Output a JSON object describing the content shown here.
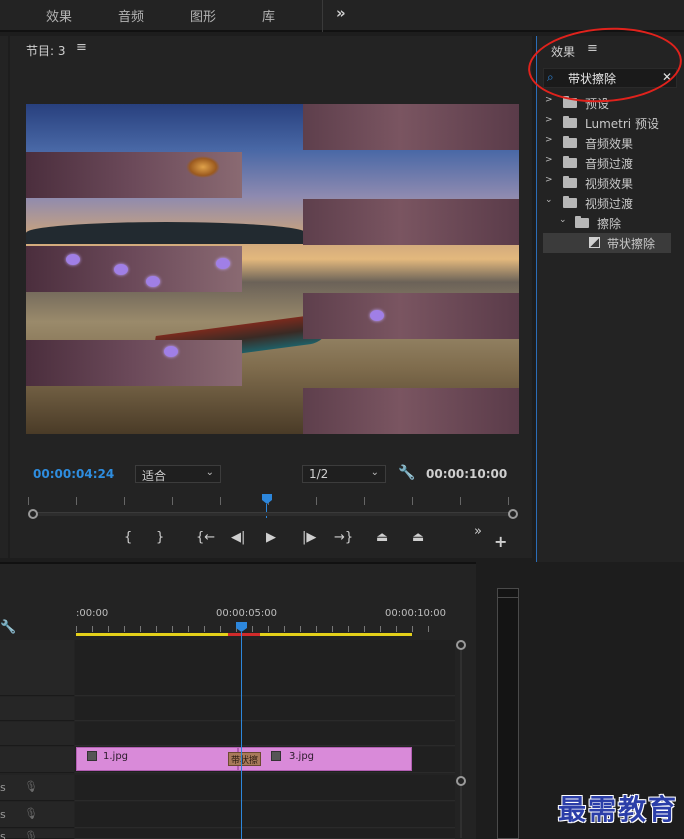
{
  "topbar": {
    "workspaces": [
      "效果",
      "音频",
      "图形",
      "库"
    ],
    "more_glyph": "»"
  },
  "program_monitor": {
    "title": "节目: 3",
    "menu_glyph": "≡",
    "current_timecode": "00:00:04:24",
    "zoom": "适合",
    "resolution": "1/2",
    "duration_timecode": "00:00:10:00",
    "playhead_fraction": 0.48,
    "transport": [
      "{",
      "}",
      "{←",
      "◀|",
      "▶",
      "|▶",
      "→}",
      "⏏",
      "⏏",
      "»",
      "+"
    ]
  },
  "effects_panel": {
    "title": "效果",
    "menu_glyph": "≡",
    "search_value": "带状擦除",
    "tree": [
      {
        "label": "预设",
        "level": 0,
        "expanded": false
      },
      {
        "label": "Lumetri 预设",
        "level": 0,
        "expanded": false
      },
      {
        "label": "音频效果",
        "level": 0,
        "expanded": false
      },
      {
        "label": "音频过渡",
        "level": 0,
        "expanded": false
      },
      {
        "label": "视频效果",
        "level": 0,
        "expanded": false
      },
      {
        "label": "视频过渡",
        "level": 0,
        "expanded": true
      },
      {
        "label": "擦除",
        "level": 1,
        "expanded": true
      },
      {
        "label": "带状擦除",
        "level": 2,
        "selected": true
      }
    ]
  },
  "timeline": {
    "ruler_labels": [
      ":00:00",
      "00:00:05:00",
      "00:00:10:00"
    ],
    "clips": [
      {
        "name": "1.jpg"
      },
      {
        "name": "3.jpg"
      }
    ],
    "transition_label": "带状擦",
    "track_labels": [
      "s",
      "s",
      "s"
    ]
  },
  "watermark": "最需教育",
  "colors": {
    "accent": "#2d87dc",
    "clip": "#d98ad9",
    "annotation": "#e0221c",
    "workarea": "#e5d11a"
  }
}
